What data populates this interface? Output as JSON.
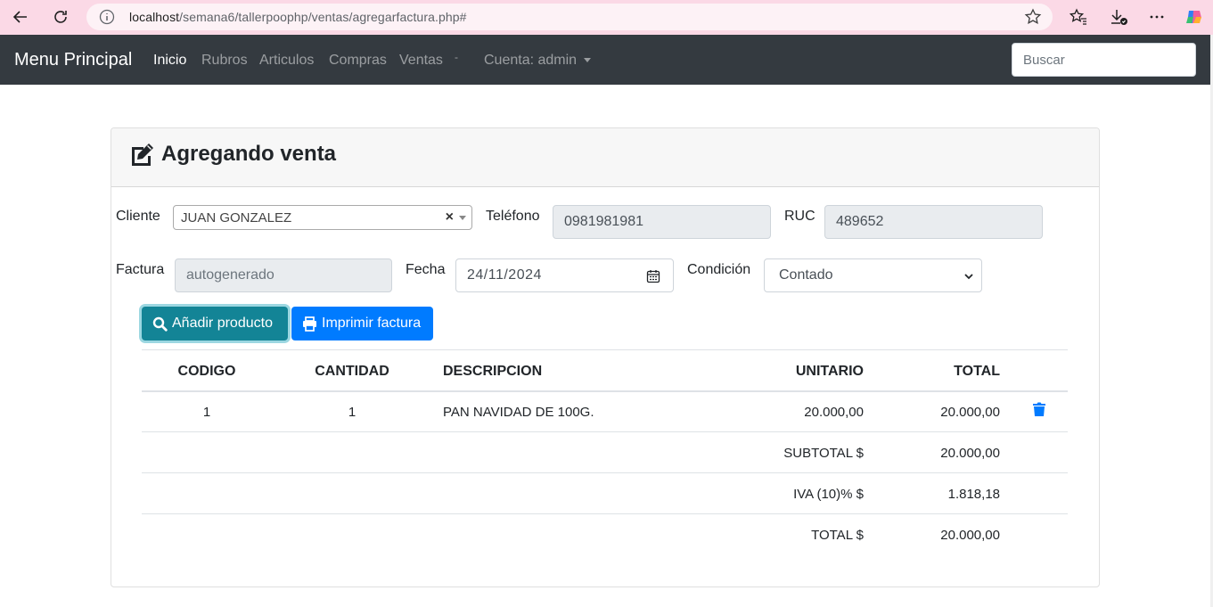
{
  "browser": {
    "url_host": "localhost",
    "url_path": "/semana6/tallerpoophp/ventas/agregarfactura.php#"
  },
  "navbar": {
    "brand": "Menu Principal",
    "items": [
      "Inicio",
      "Rubros",
      "Articulos",
      "Compras",
      "Ventas"
    ],
    "extra": "-",
    "account": "Cuenta: admin",
    "search_placeholder": "Buscar"
  },
  "card": {
    "title": "Agregando venta"
  },
  "form": {
    "cliente_label": "Cliente",
    "cliente_value": "JUAN GONZALEZ",
    "clear": "×",
    "telefono_label": "Teléfono",
    "telefono_value": "0981981981",
    "ruc_label": "RUC",
    "ruc_value": "489652",
    "factura_label": "Factura",
    "factura_placeholder": "autogenerado",
    "fecha_label": "Fecha",
    "fecha_value": "24/11/2024",
    "condicion_label": "Condición",
    "condicion_value": "Contado"
  },
  "buttons": {
    "add_product": "Añadir producto",
    "print_invoice": "Imprimir factura"
  },
  "table": {
    "headers": [
      "CODIGO",
      "CANTIDAD",
      "DESCRIPCION",
      "UNITARIO",
      "TOTAL"
    ],
    "rows": [
      {
        "codigo": "1",
        "cantidad": "1",
        "descripcion": "PAN NAVIDAD DE 100G.",
        "unitario": "20.000,00",
        "total": "20.000,00"
      }
    ],
    "subtotal_label": "SUBTOTAL $",
    "subtotal_value": "20.000,00",
    "iva_label": "IVA (10)% $",
    "iva_value": "1.818,18",
    "total_label": "TOTAL $",
    "total_value": "20.000,00"
  },
  "colors": {
    "navbar_bg": "#343a40",
    "btn_info": "#17a2b8",
    "btn_primary": "#007bff",
    "browser_bar": "#fbd9e6"
  }
}
